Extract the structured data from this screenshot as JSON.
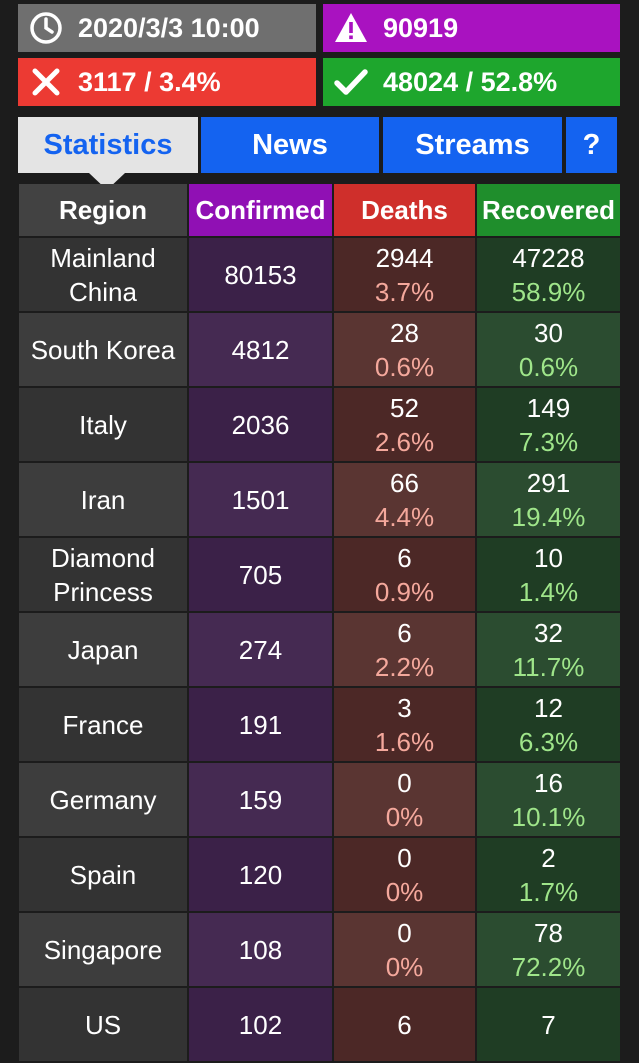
{
  "status": {
    "datetime": "2020/3/3 10:00",
    "confirmed_total": "90919",
    "deaths_total": "3117 / 3.4%",
    "recovered_total": "48024 / 52.8%"
  },
  "tabs": [
    {
      "label": "Statistics",
      "active": true
    },
    {
      "label": "News",
      "active": false
    },
    {
      "label": "Streams",
      "active": false
    },
    {
      "label": "?",
      "active": false
    }
  ],
  "table": {
    "headers": [
      "Region",
      "Confirmed",
      "Deaths",
      "Recovered"
    ],
    "rows": [
      {
        "region": "Mainland China",
        "confirmed": "80153",
        "deaths": "2944",
        "deaths_pct": "3.7%",
        "recovered": "47228",
        "recovered_pct": "58.9%"
      },
      {
        "region": "South Korea",
        "confirmed": "4812",
        "deaths": "28",
        "deaths_pct": "0.6%",
        "recovered": "30",
        "recovered_pct": "0.6%"
      },
      {
        "region": "Italy",
        "confirmed": "2036",
        "deaths": "52",
        "deaths_pct": "2.6%",
        "recovered": "149",
        "recovered_pct": "7.3%"
      },
      {
        "region": "Iran",
        "confirmed": "1501",
        "deaths": "66",
        "deaths_pct": "4.4%",
        "recovered": "291",
        "recovered_pct": "19.4%"
      },
      {
        "region": "Diamond Princess",
        "confirmed": "705",
        "deaths": "6",
        "deaths_pct": "0.9%",
        "recovered": "10",
        "recovered_pct": "1.4%"
      },
      {
        "region": "Japan",
        "confirmed": "274",
        "deaths": "6",
        "deaths_pct": "2.2%",
        "recovered": "32",
        "recovered_pct": "11.7%"
      },
      {
        "region": "France",
        "confirmed": "191",
        "deaths": "3",
        "deaths_pct": "1.6%",
        "recovered": "12",
        "recovered_pct": "6.3%"
      },
      {
        "region": "Germany",
        "confirmed": "159",
        "deaths": "0",
        "deaths_pct": "0%",
        "recovered": "16",
        "recovered_pct": "10.1%"
      },
      {
        "region": "Spain",
        "confirmed": "120",
        "deaths": "0",
        "deaths_pct": "0%",
        "recovered": "2",
        "recovered_pct": "1.7%"
      },
      {
        "region": "Singapore",
        "confirmed": "108",
        "deaths": "0",
        "deaths_pct": "0%",
        "recovered": "78",
        "recovered_pct": "72.2%"
      },
      {
        "region": "US",
        "confirmed": "102",
        "deaths": "6",
        "deaths_pct": "",
        "recovered": "7",
        "recovered_pct": ""
      }
    ]
  },
  "icons": {
    "time": "clock-icon",
    "confirmed": "warning-icon",
    "deaths": "close-icon",
    "recovered": "check-icon"
  },
  "colors": {
    "time_bg": "#6f6f6f",
    "confirmed": "#a912c0",
    "deaths": "#ec3a33",
    "recovered": "#1ea62d",
    "tab_blue": "#1463f0"
  }
}
